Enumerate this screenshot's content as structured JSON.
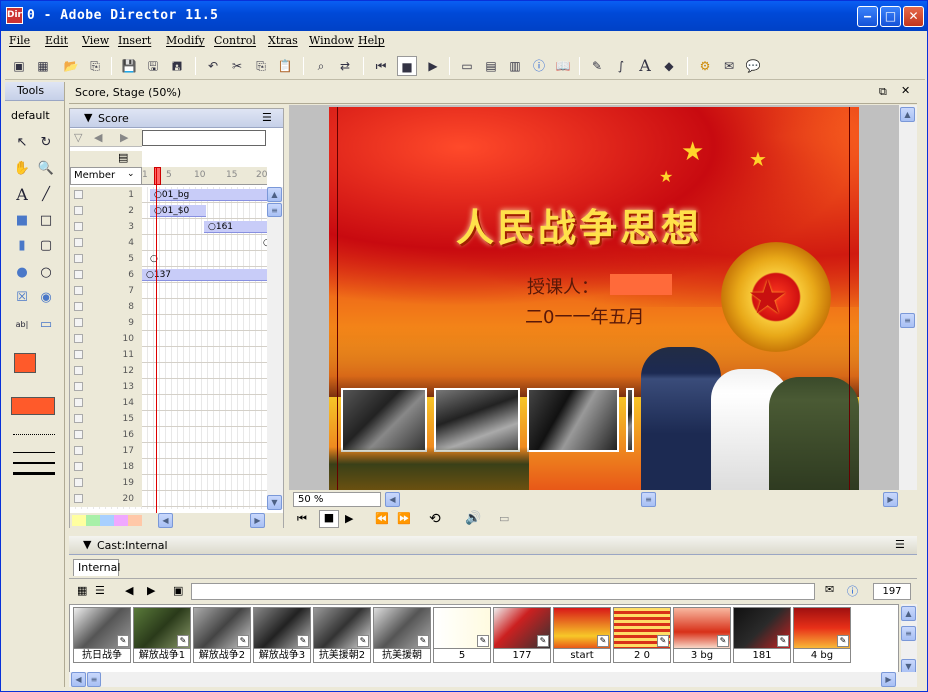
{
  "window": {
    "title": "0 - Adobe Director 11.5",
    "app_icon": "Dir"
  },
  "menu": [
    "File",
    "Edit",
    "View",
    "Insert",
    "Modify",
    "Control",
    "Xtras",
    "Window",
    "Help"
  ],
  "tools_panel": {
    "title": "Tools",
    "preset": "default"
  },
  "document_tab": {
    "title": "Score, Stage (50%)"
  },
  "score": {
    "title": "Score",
    "member_select": "Member",
    "frame_ticks": [
      "1",
      "5",
      "10",
      "15",
      "20"
    ],
    "channels": [
      "1",
      "2",
      "3",
      "4",
      "5",
      "6",
      "7",
      "8",
      "9",
      "10",
      "11",
      "12",
      "13",
      "14",
      "15",
      "16",
      "17",
      "18",
      "19",
      "20"
    ],
    "sprites": [
      {
        "label": "01_bg"
      },
      {
        "label": "01_$0"
      },
      {
        "label": "161"
      },
      {
        "label": "137"
      }
    ]
  },
  "stage": {
    "zoom": "50 %",
    "slide_title": "人民战争思想",
    "lecturer_label": "授课人：",
    "date_text": "二0一一年五月"
  },
  "cast": {
    "title": "Cast:Internal",
    "tab": "Internal",
    "count": "197",
    "members": [
      "抗日战争",
      "解放战争1",
      "解放战争2",
      "解放战争3",
      "抗美援朝2",
      "抗美援朝",
      "5",
      "177",
      "start",
      "2 0",
      "3 bg",
      "181",
      "4 bg"
    ]
  },
  "colors": {
    "titlebar": "#0049d8",
    "accent_orange": "#ff5a2a",
    "stage_red": "#d81818",
    "stage_yellow": "#f7d23a"
  }
}
